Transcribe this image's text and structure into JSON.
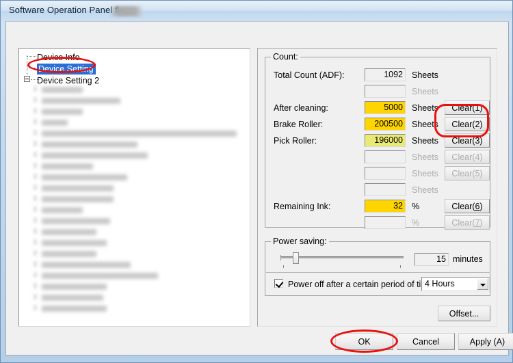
{
  "window": {
    "title": "Software Operation Panel fi-",
    "title_redacted": true,
    "accent_title_bar": "#cfe0f1"
  },
  "tree": {
    "items": [
      {
        "label": "Device Info",
        "selected": false,
        "has_expander": false
      },
      {
        "label": "Device Setting",
        "selected": true,
        "has_expander": false
      },
      {
        "label": "Device Setting 2",
        "selected": false,
        "has_expander": true
      }
    ],
    "child_items_blurred": true,
    "child_item_count": 21,
    "selection_color": "#2a6fd6"
  },
  "count_group": {
    "title": "Count:",
    "rows": [
      {
        "label": "Total Count (ADF):",
        "value": "1092",
        "field_state": "readonly",
        "unit": "Sheets",
        "unit_enabled": true,
        "clear_button": null,
        "clear_enabled": false
      },
      {
        "label": "",
        "value": "",
        "field_state": "empty",
        "unit": "Sheets",
        "unit_enabled": false,
        "clear_button": null,
        "clear_enabled": false
      },
      {
        "label": "After cleaning:",
        "value": "5000",
        "field_state": "gold",
        "unit": "Sheets",
        "unit_enabled": true,
        "clear_button": "Clear(1)",
        "clear_enabled": true
      },
      {
        "label": "Brake Roller:",
        "value": "200500",
        "field_state": "gold",
        "unit": "Sheets",
        "unit_enabled": true,
        "clear_button": "Clear(2)",
        "clear_enabled": true
      },
      {
        "label": "Pick Roller:",
        "value": "196000",
        "field_state": "lightyellow",
        "unit": "Sheets",
        "unit_enabled": true,
        "clear_button": "Clear(3)",
        "clear_enabled": true
      },
      {
        "label": "",
        "value": "",
        "field_state": "empty",
        "unit": "Sheets",
        "unit_enabled": false,
        "clear_button": "Clear(4)",
        "clear_enabled": false
      },
      {
        "label": "",
        "value": "",
        "field_state": "empty",
        "unit": "Sheets",
        "unit_enabled": false,
        "clear_button": "Clear(5)",
        "clear_enabled": false
      },
      {
        "label": "",
        "value": "",
        "field_state": "empty",
        "unit": "Sheets",
        "unit_enabled": false,
        "clear_button": null,
        "clear_enabled": false
      },
      {
        "label": "Remaining Ink:",
        "value": "32",
        "field_state": "gold",
        "unit": "%",
        "unit_enabled": true,
        "clear_button": "Clear(6)",
        "clear_enabled": true
      },
      {
        "label": "",
        "value": "",
        "field_state": "empty",
        "unit": "%",
        "unit_enabled": false,
        "clear_button": "Clear(7)",
        "clear_enabled": false
      }
    ],
    "colors": {
      "gold": "#ffd500",
      "light_yellow": "#e9ea73"
    }
  },
  "power_saving_group": {
    "title": "Power saving:",
    "slider": {
      "value_percent": 10,
      "min_tick": true,
      "max_tick": true
    },
    "minutes_value": "15",
    "minutes_unit": "minutes",
    "power_off_checkbox": {
      "label": "Power off after a certain period of time",
      "checked": true
    },
    "power_off_dropdown": {
      "selected": "4 Hours"
    }
  },
  "offset_button": {
    "label": "Offset..."
  },
  "footer": {
    "ok": "OK",
    "cancel": "Cancel",
    "apply": "Apply (A)"
  },
  "annotations": {
    "tree_selected_ellipse": true,
    "clear_2_3_highlight": true,
    "ok_ellipse": true,
    "color": "#e8110e"
  }
}
